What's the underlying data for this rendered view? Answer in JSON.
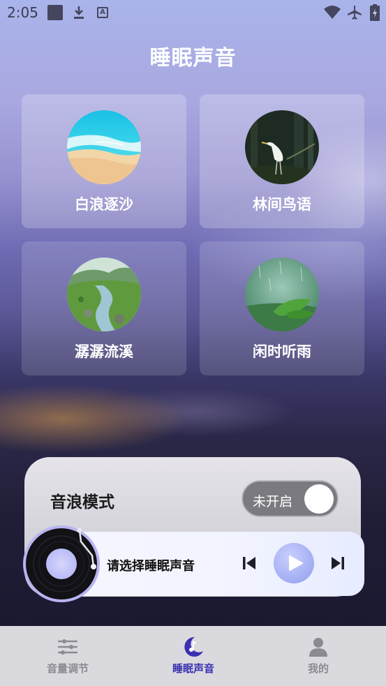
{
  "status_bar": {
    "time": "2:05",
    "icons": [
      "notification-square-icon",
      "download-icon",
      "text-a-icon",
      "wifi-icon",
      "airplane-mode-icon",
      "battery-icon"
    ],
    "icon_color": "#45465e",
    "text_a": "A"
  },
  "header": {
    "title": "睡眠声音"
  },
  "sounds": [
    {
      "label": "白浪逐沙",
      "image": "ocean-beach-image"
    },
    {
      "label": "林间鸟语",
      "image": "egret-forest-image"
    },
    {
      "label": "潺潺流溪",
      "image": "mountain-stream-image"
    },
    {
      "label": "闲时听雨",
      "image": "rain-leaves-image"
    }
  ],
  "wave_mode": {
    "label": "音浪模式",
    "toggle_text": "未开启",
    "enabled": false
  },
  "player": {
    "now_playing": "请选择睡眠声音",
    "controls": [
      "previous-icon",
      "play-icon",
      "next-icon"
    ],
    "accent": "#9aa5f2"
  },
  "bottom_nav": {
    "items": [
      {
        "label": "音量调节",
        "icon": "sliders-icon",
        "active": false
      },
      {
        "label": "睡眠声音",
        "icon": "moon-note-icon",
        "active": true
      },
      {
        "label": "我的",
        "icon": "user-icon",
        "active": false
      }
    ],
    "active_color": "#3a2fb0",
    "inactive_color": "#8a8a90"
  }
}
